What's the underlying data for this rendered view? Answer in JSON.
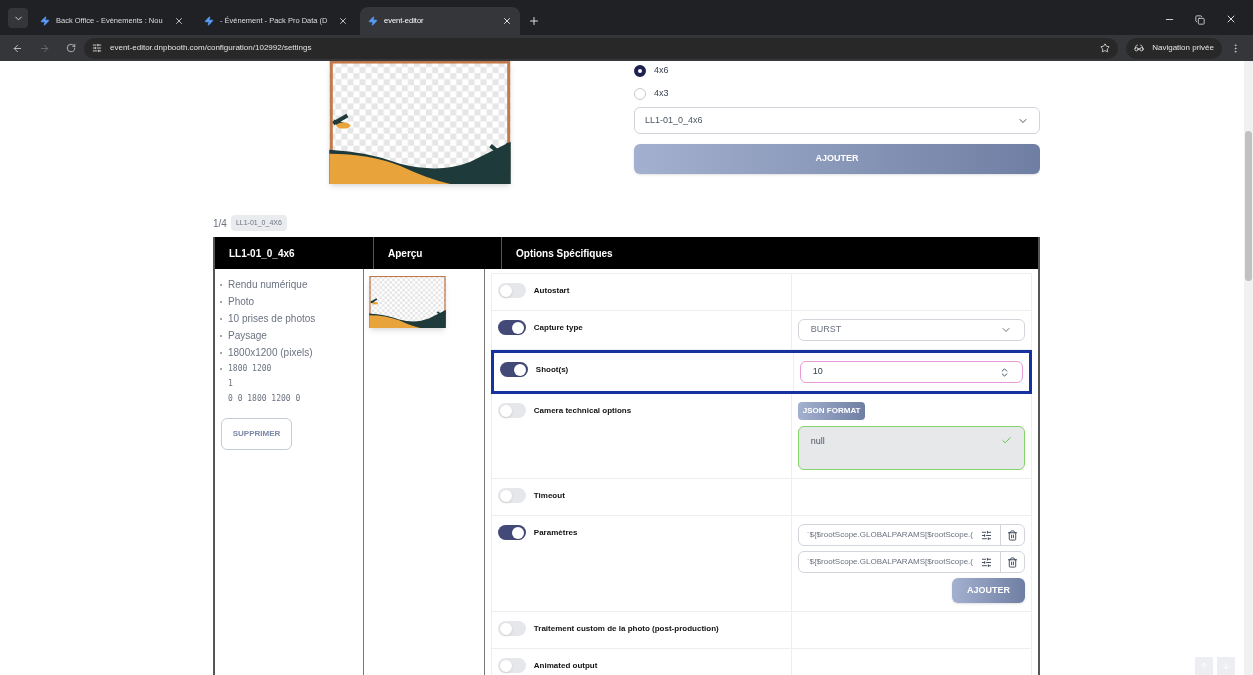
{
  "browser": {
    "tabs": [
      {
        "title": "Back Office - Evènements : Nou",
        "selected": false
      },
      {
        "title": "- Événement - Pack Pro Data (D",
        "selected": false
      },
      {
        "title": "event-editor",
        "selected": true
      }
    ],
    "url": "event-editor.dnpbooth.com/configuration/102992/settings",
    "private_label": "Navigation privée"
  },
  "format_options": [
    {
      "label": "4x6",
      "selected": true
    },
    {
      "label": "4x3",
      "selected": false
    }
  ],
  "template_select": {
    "value": "LL1-01_0_4x6"
  },
  "add_button": "AJOUTER",
  "pagination": {
    "position": "1/4",
    "tag": "LL1-01_0_4X6"
  },
  "table": {
    "columns": [
      "LL1-01_0_4x6",
      "Aperçu",
      "Options Spécifiques"
    ],
    "details": [
      "Rendu numérique",
      "Photo",
      "10 prises de photos",
      "Paysage",
      "1800x1200 (pixels)"
    ],
    "mono_lines": [
      "1800 1200",
      "1",
      "0 0 1800 1200 0"
    ],
    "delete_button": "SUPPRIMER",
    "options": [
      {
        "label": "Autostart",
        "on": false,
        "highlighted": false,
        "kind": "none"
      },
      {
        "label": "Capture type",
        "on": true,
        "highlighted": false,
        "kind": "select",
        "value": "BURST"
      },
      {
        "label": "Shoot(s)",
        "on": true,
        "highlighted": true,
        "kind": "number",
        "value": "10"
      },
      {
        "label": "Camera technical options",
        "on": false,
        "highlighted": false,
        "kind": "json",
        "badge": "JSON FORMAT",
        "value": "null"
      },
      {
        "label": "Timeout",
        "on": false,
        "highlighted": false,
        "kind": "none"
      },
      {
        "label": "Paramètres",
        "on": true,
        "highlighted": false,
        "kind": "params",
        "params": [
          "`${$rootScope.GLOBALPARAMS[$rootScope.(",
          "`${$rootScope.GLOBALPARAMS[$rootScope.("
        ],
        "button": "AJOUTER"
      },
      {
        "label": "Traitement custom de la photo (post-production)",
        "on": false,
        "highlighted": false,
        "kind": "none"
      },
      {
        "label": "Animated output",
        "on": false,
        "highlighted": false,
        "kind": "none"
      }
    ]
  }
}
